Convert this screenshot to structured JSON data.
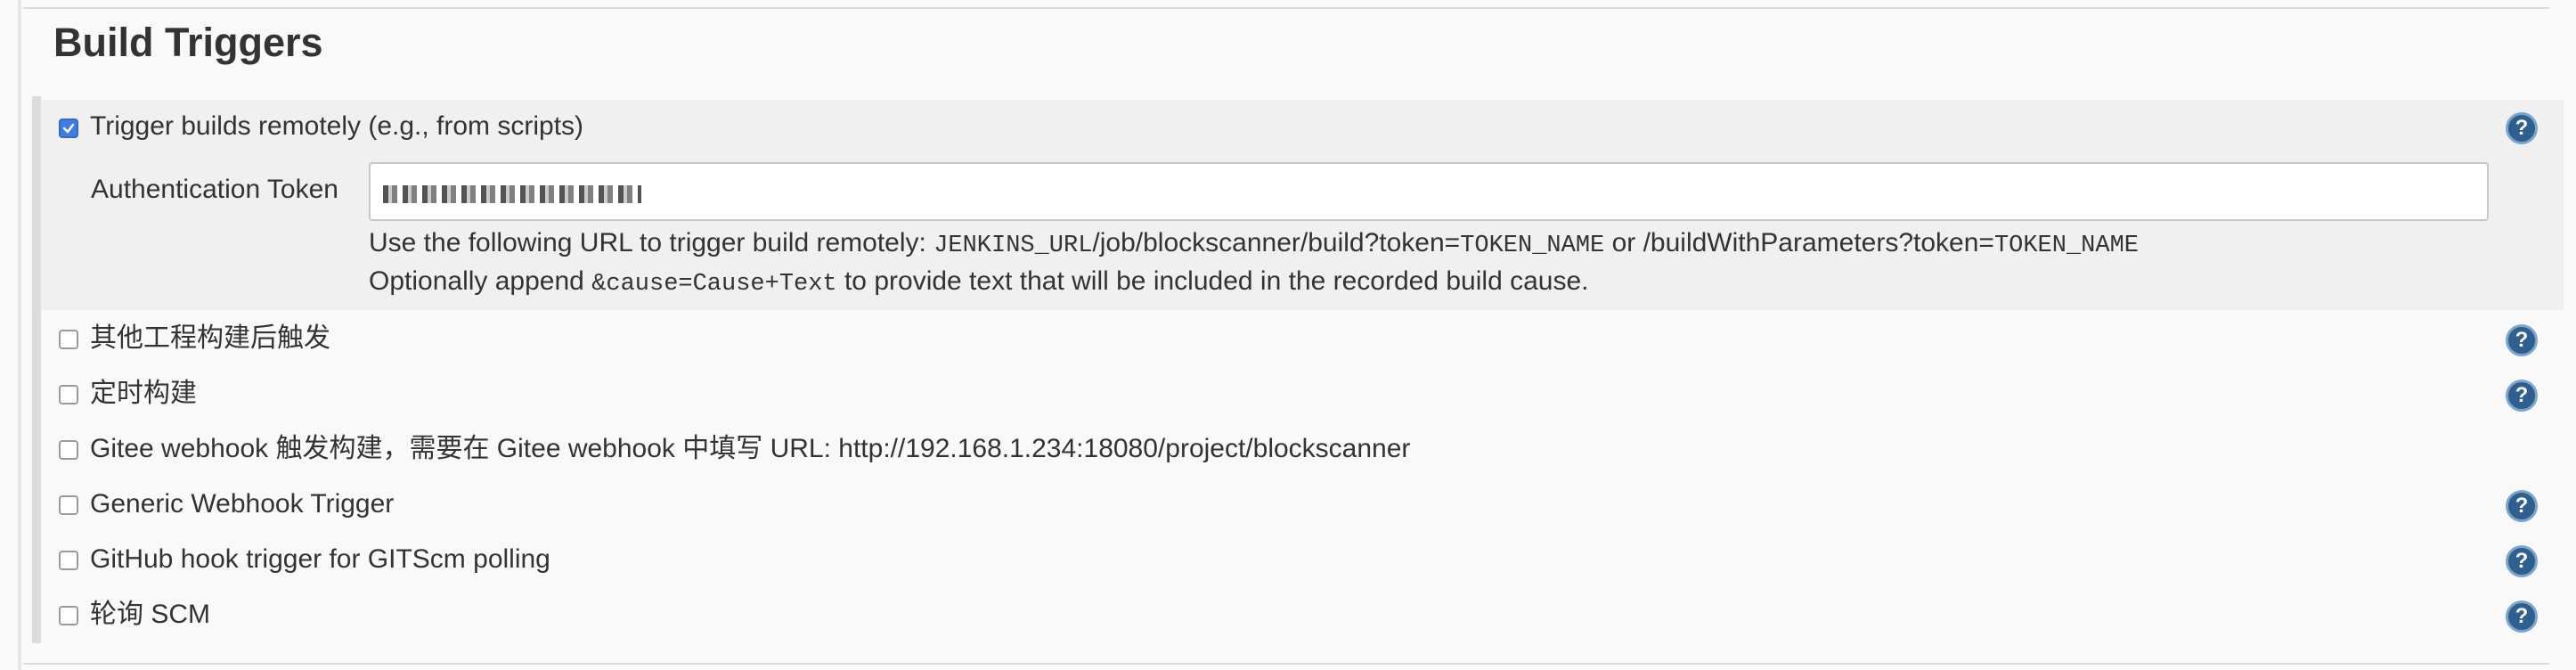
{
  "section": {
    "title": "Build Triggers"
  },
  "triggers": [
    {
      "label": "Trigger builds remotely (e.g., from scripts)",
      "checked": true,
      "help": "?"
    },
    {
      "label": "其他工程构建后触发",
      "checked": false,
      "help": "?"
    },
    {
      "label": "定时构建",
      "checked": false,
      "help": "?"
    },
    {
      "label": "Gitee webhook 触发构建，需要在 Gitee webhook 中填写 URL: http://192.168.1.234:18080/project/blockscanner",
      "checked": false
    },
    {
      "label": "Generic Webhook Trigger",
      "checked": false,
      "help": "?"
    },
    {
      "label": "GitHub hook trigger for GITScm polling",
      "checked": false,
      "help": "?"
    },
    {
      "label": "轮询 SCM",
      "checked": false,
      "help": "?"
    }
  ],
  "auth": {
    "label": "Authentication Token",
    "line1": {
      "prefix": "Use the following URL to trigger build remotely: ",
      "code1": "JENKINS_URL",
      "mid": "/job/blockscanner/build?token=",
      "code2": "TOKEN_NAME",
      "mid2": " or /buildWithParameters?token=",
      "code3": "TOKEN_NAME"
    },
    "line2": {
      "prefix": "Optionally append ",
      "code": "&cause=Cause+Text",
      "suffix": " to provide text that will be included in the recorded build cause."
    }
  },
  "colors": {
    "accent": "#3d7ee0",
    "help_icon": "#2f5f8f",
    "background": "#f9f9f9"
  }
}
